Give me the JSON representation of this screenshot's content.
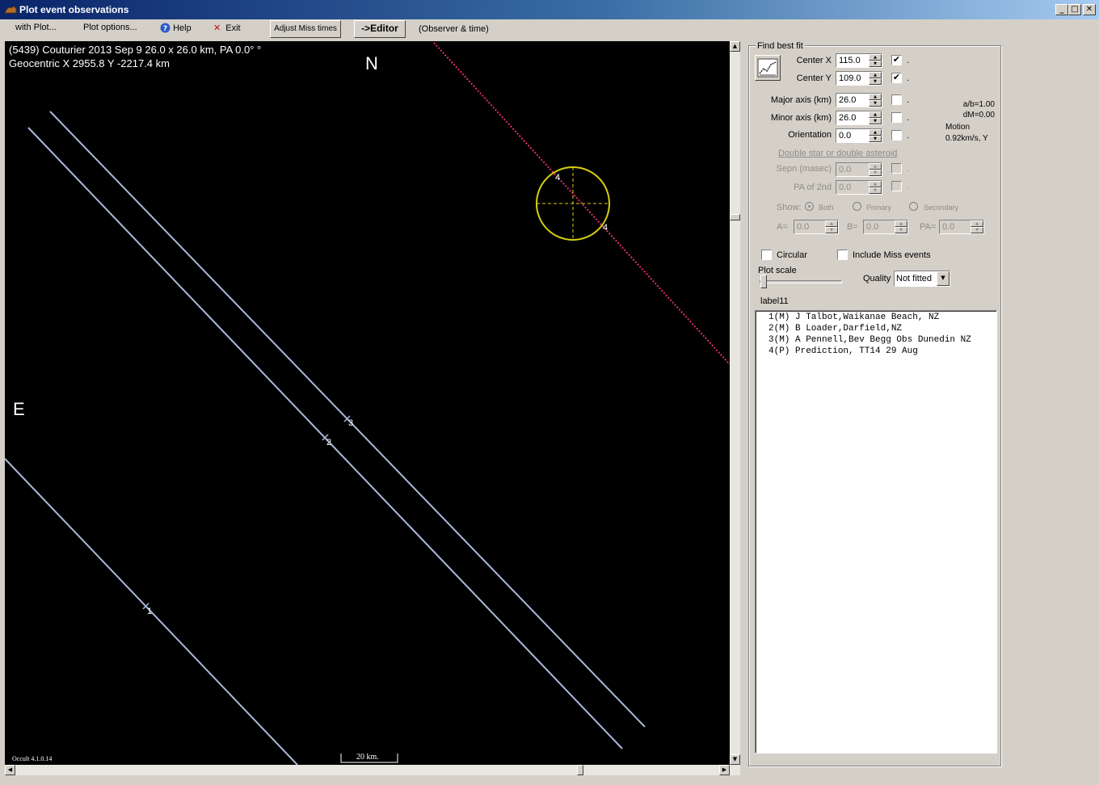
{
  "window": {
    "title": "Plot event observations",
    "minimize": "_",
    "maximize": "□",
    "close": "✕"
  },
  "menu": {
    "with_plot": "with Plot...",
    "plot_options": "Plot options...",
    "help": "Help",
    "exit": "Exit",
    "adjust_miss": "Adjust Miss times",
    "editor": "->Editor",
    "observer_time": "(Observer & time)"
  },
  "plot": {
    "header_line1": "(5439) Couturier  2013 Sep 9   26.0 x 26.0 km, PA 0.0° °",
    "header_line2": "Geocentric X 2955.8  Y -2217.4 km",
    "north": "N",
    "east": "E",
    "chord_label_1": "1",
    "chord_label_2": "2",
    "chord_label_3": "3",
    "prediction_label_a": "4",
    "prediction_label_b": "4",
    "version": "Occult 4.1.0.14",
    "scale": "20 km."
  },
  "panel": {
    "group_title": "Find best fit",
    "center_x_label": "Center X",
    "center_x": "115.0",
    "center_x_checked": "✔",
    "center_y_label": "Center Y",
    "center_y": "109.0",
    "center_y_checked": "✔",
    "major_label": "Major axis (km)",
    "major": "26.0",
    "minor_label": "Minor axis (km)",
    "minor": "26.0",
    "orientation_label": "Orientation",
    "orientation": "0.0",
    "ab_ratio": "a/b=1.00",
    "dm": "dM=0.00",
    "motion_label": "Motion",
    "motion_value": "0.92km/s, Y",
    "double_label": "Double star  or  double asteroid",
    "sepn_label": "Sepn (masec)",
    "sepn": "0.0",
    "pa2_label": "PA of 2nd",
    "pa2": "0.0",
    "show_label": "Show:",
    "radio_both": "Both",
    "radio_primary": "Primary",
    "radio_secondary": "Secondary",
    "a_label": "A=",
    "a_val": "0.0",
    "b_label": "B=",
    "b_val": "0.0",
    "pa_label": "PA=",
    "pa_val": "0.0",
    "circular_label": "Circular",
    "include_miss_label": "Include Miss events",
    "plot_scale_label": "Plot scale",
    "quality_label": "Quality",
    "quality_value": "Not fitted",
    "label11": "label11",
    "dot": "."
  },
  "observers": [
    "1(M) J Talbot,Waikanae Beach, NZ",
    "2(M) B Loader,Darfield,NZ",
    "3(M) A Pennell,Bev Begg Obs Dunedin NZ",
    "4(P) Prediction, TT14 29 Aug"
  ],
  "colors": {
    "chord": "#aab8d8",
    "ellipse": "#d8d010",
    "prediction": "#e0306a",
    "plot_bg": "#000000"
  }
}
